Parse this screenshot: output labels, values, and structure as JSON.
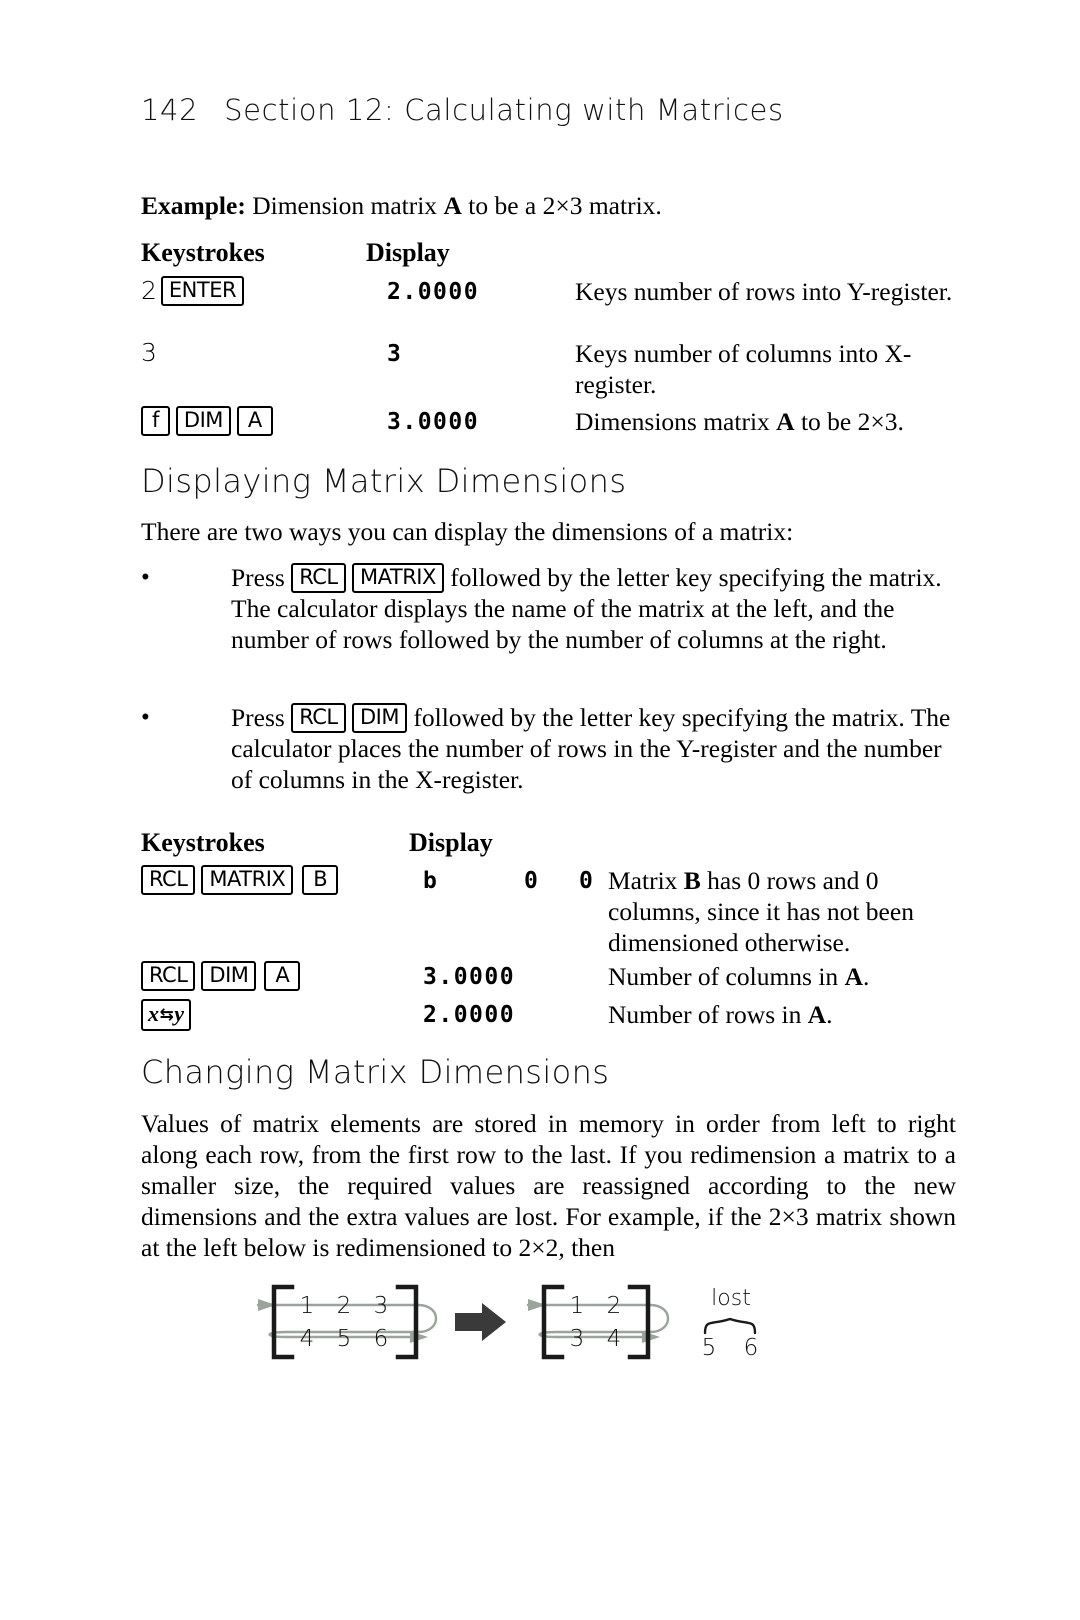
{
  "header": {
    "folio": "142",
    "title": "Section 12: Calculating with Matrices"
  },
  "example": {
    "label": "Example:",
    "text": " Dimension matrix ",
    "matrix_name": "A",
    "text2": " to be a 2×3 matrix."
  },
  "table1": {
    "col_keystrokes": "Keystrokes",
    "col_display": "Display",
    "rows": [
      {
        "keys_prefix": "2",
        "keys": [
          "ENTER"
        ],
        "display": "2.0000",
        "note": "Keys number of rows into Y-register."
      },
      {
        "keys_prefix": "3",
        "keys": [],
        "display": "3",
        "note": "Keys number of columns into X-register."
      },
      {
        "keys_prefix": "",
        "keys": [
          "f",
          "DIM",
          "A"
        ],
        "display": "3.0000",
        "note_pre": "Dimensions matrix ",
        "note_bold": "A",
        "note_post": " to be 2×3."
      }
    ]
  },
  "section1": {
    "heading": "Displaying Matrix Dimensions",
    "intro": "There are two ways you can display the dimensions of a matrix:",
    "bullets": [
      {
        "marker": "•",
        "pre": "Press ",
        "keys": [
          "RCL",
          "MATRIX"
        ],
        "post": " followed by the letter key specifying the matrix. The calculator displays the name of the matrix at the left, and the number of rows followed by the number of columns at the right."
      },
      {
        "marker": "•",
        "pre": "Press ",
        "keys": [
          "RCL",
          "DIM"
        ],
        "post": " followed by the letter key specifying the matrix. The calculator places the number of rows in the Y-register and the number of columns in the X-register."
      }
    ]
  },
  "table2": {
    "col_keystrokes": "Keystrokes",
    "col_display": "Display",
    "rows": [
      {
        "keys": [
          "RCL",
          "MATRIX",
          "B"
        ],
        "display_name": "b",
        "display_rows": "0",
        "display_cols": "0",
        "note_pre": "Matrix ",
        "note_bold": "B",
        "note_post": " has 0 rows and 0 columns, since it has not been dimensioned otherwise."
      },
      {
        "keys": [
          "RCL",
          "DIM",
          "A"
        ],
        "display": "3.0000",
        "note_pre": "Number of columns in ",
        "note_bold": "A",
        "note_post": "."
      },
      {
        "keys": [
          "x⇄y"
        ],
        "key_swap_left": "x",
        "key_swap_arrows": "⇆",
        "key_swap_right": "y",
        "display": "2.0000",
        "note_pre": "Number of rows in ",
        "note_bold": "A",
        "note_post": "."
      }
    ]
  },
  "section2": {
    "heading": "Changing Matrix Dimensions",
    "paragraph": "Values of matrix elements are stored in memory in order from left to right along each row, from the first row to the last. If you redimension a matrix to a smaller size, the required values are reassigned according to the new dimensions and the extra values are lost. For example, if the 2×3 matrix shown at the left below is redimensioned to 2×2, then"
  },
  "figure": {
    "matrix_before": {
      "rows": [
        [
          "1",
          "2",
          "3"
        ],
        [
          "4",
          "5",
          "6"
        ]
      ]
    },
    "matrix_after": {
      "rows": [
        [
          "1",
          "2"
        ],
        [
          "3",
          "4"
        ]
      ]
    },
    "lost_label": "lost",
    "lost_values": [
      "5",
      "6"
    ],
    "arrow": "right-arrow",
    "trace_color": "#9aa49a",
    "bracket_color": "#1a1a1a"
  }
}
